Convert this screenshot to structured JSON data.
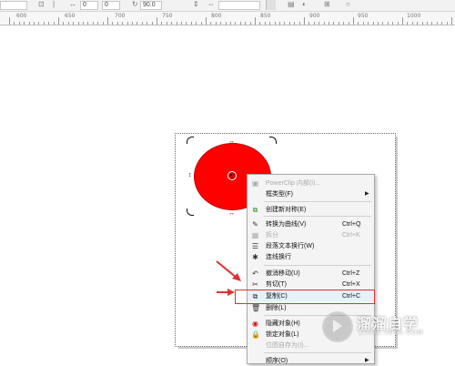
{
  "toolbar": {
    "angle_value": "90.0",
    "field_a": "0",
    "field_b": "0"
  },
  "ruler": {
    "labels": [
      "600",
      "650",
      "700",
      "750",
      "800",
      "850",
      "900",
      "950",
      "1000"
    ]
  },
  "context_menu": {
    "items": [
      {
        "label": "PowerClip 内部(I)...",
        "shortcut": "",
        "icon": "powerclip-icon",
        "disabled": true,
        "submenu": false
      },
      {
        "label": "框类型(F)",
        "shortcut": "",
        "icon": "",
        "disabled": false,
        "submenu": true
      },
      {
        "label": "创建新对称(E)",
        "shortcut": "",
        "icon": "symmetry-icon",
        "disabled": false,
        "submenu": false
      },
      {
        "label": "转换为曲线(V)",
        "shortcut": "Ctrl+Q",
        "icon": "convert-curve-icon",
        "disabled": false,
        "submenu": false
      },
      {
        "label": "拆分",
        "shortcut": "Ctrl+K",
        "icon": "split-icon",
        "disabled": true,
        "submenu": false
      },
      {
        "label": "段落文本换行(W)",
        "shortcut": "",
        "icon": "text-wrap-icon",
        "disabled": false,
        "submenu": false
      },
      {
        "label": "连线换行",
        "shortcut": "",
        "icon": "wrap-line-icon",
        "disabled": false,
        "submenu": false
      },
      {
        "label": "撤消移动(U)",
        "shortcut": "Ctrl+Z",
        "icon": "undo-icon",
        "disabled": false,
        "submenu": false
      },
      {
        "label": "剪切(T)",
        "shortcut": "Ctrl+X",
        "icon": "cut-icon",
        "disabled": false,
        "submenu": false
      },
      {
        "label": "复制(C)",
        "shortcut": "Ctrl+C",
        "icon": "copy-icon",
        "disabled": false,
        "submenu": false
      },
      {
        "label": "删除(L)",
        "shortcut": "",
        "icon": "delete-icon",
        "disabled": false,
        "submenu": false
      },
      {
        "label": "隐藏对象(H)",
        "shortcut": "",
        "icon": "hide-icon",
        "disabled": false,
        "submenu": false
      },
      {
        "label": "锁定对象(L)",
        "shortcut": "",
        "icon": "lock-icon",
        "disabled": false,
        "submenu": false
      },
      {
        "label": "位图自存为(I)...",
        "shortcut": "",
        "icon": "",
        "disabled": true,
        "submenu": false
      },
      {
        "label": "顺序(O)",
        "shortcut": "",
        "icon": "",
        "disabled": false,
        "submenu": true
      }
    ]
  },
  "watermark": {
    "title": "溜溜自学",
    "subtitle": "ZIXUE.3D66.COM"
  },
  "colors": {
    "shape_fill": "#ff0000",
    "highlight": "#e03030"
  }
}
